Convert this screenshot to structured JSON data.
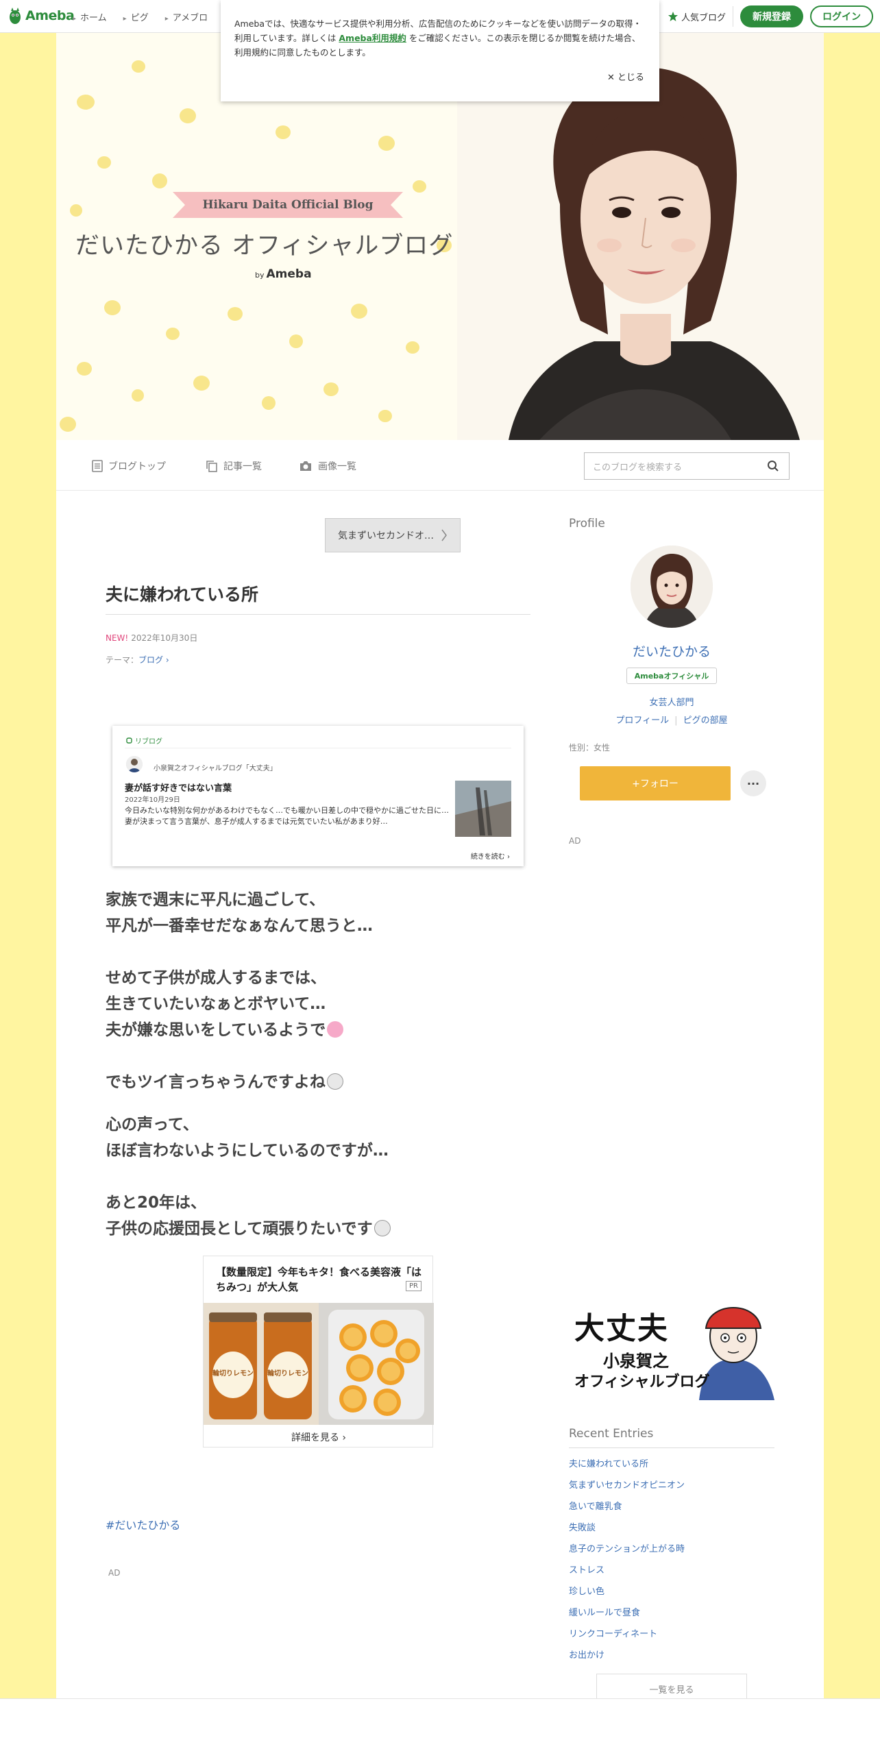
{
  "topbar": {
    "logo": "Ameba",
    "nav": [
      "ホーム",
      "ピグ",
      "アメブロ"
    ],
    "popular": "人気ブログ",
    "register": "新規登録",
    "login": "ログイン"
  },
  "cookie": {
    "text_before": "Amebaでは、快適なサービス提供や利用分析、広告配信のためにクッキーなどを使い訪問データの取得・利用しています。詳しくは",
    "link": "Ameba利用規約",
    "text_after": "をご確認ください。この表示を閉じるか閲覧を続けた場合、利用規約に同意したものとします。",
    "close": "とじる"
  },
  "header": {
    "ribbon": "Hikaru Daita Official Blog",
    "title": "だいたひかる オフィシャルブログ",
    "by": "by",
    "ameba": "Ameba"
  },
  "subnav": {
    "items": [
      "ブログトップ",
      "記事一覧",
      "画像一覧"
    ],
    "search_placeholder": "このブログを検索する"
  },
  "article": {
    "prev_label": "気まずいセカンドオ…",
    "title": "夫に嫌われている所",
    "new": "NEW!",
    "date": "2022年10月30日",
    "theme_label": "テーマ：",
    "theme": "ブログ",
    "reblog": {
      "label": "リブログ",
      "source": "小泉賀之オフィシャルブログ「大丈夫」",
      "title": "妻が話す好きではない言葉",
      "date": "2022年10月29日",
      "excerpt": "今日みたいな特別な何かがあるわけでもなく…でも暖かい日差しの中で穏やかに過ごせた日に…妻が決まって言う言葉が、息子が成人するまでは元気でいたい私があまり好…",
      "more": "続きを読む"
    },
    "paragraphs": [
      [
        "家族で週末に平凡に過ごして、",
        "平凡が一番幸せだなぁなんて思うと…"
      ],
      [
        "せめて子供が成人するまでは、",
        "生きていたいなぁとボヤいて…",
        "夫が嫌な思いをしているようで"
      ],
      [
        "でもツイ言っちゃうんですよね"
      ],
      [
        "心の声って、",
        "ほぼ言わないようにしているのですが…"
      ],
      [
        "あと20年は、",
        "子供の応援団長として頑張りたいです"
      ]
    ],
    "ad": {
      "title": "【数量限定】今年もキタ！食べる美容液「はちみつ」が大人気",
      "pr": "PR",
      "jar_label": "輪切りレモン",
      "more": "詳細を見る"
    },
    "hashtag": "#だいたひかる",
    "ad_label": "AD"
  },
  "sidebar": {
    "profile_heading": "Profile",
    "name": "だいたひかる",
    "badge": "Amebaオフィシャル",
    "genre": "女芸人部門",
    "links": [
      "プロフィール",
      "ピグの部屋"
    ],
    "gender": "性別：女性",
    "follow": "+フォロー",
    "more": "···",
    "ad_label": "AD",
    "banner": {
      "line1": "大丈夫",
      "line2": "小泉賀之",
      "line3": "オフィシャルブログ"
    },
    "recent_heading": "Recent Entries",
    "recent": [
      "夫に嫌われている所",
      "気まずいセカンドオピニオン",
      "急いで離乳食",
      "失敗談",
      "息子のテンションが上がる時",
      "ストレス",
      "珍しい色",
      "緩いルールで昼食",
      "リンクコーディネート",
      "お出かけ"
    ],
    "list_all": "一覧を見る"
  },
  "colors": {
    "brand_green": "#2d8c3c",
    "page_yellow": "#fff5a0",
    "link_blue": "#3d6fb4",
    "follow_orange": "#f0b53a",
    "new_pink": "#e0457b"
  }
}
